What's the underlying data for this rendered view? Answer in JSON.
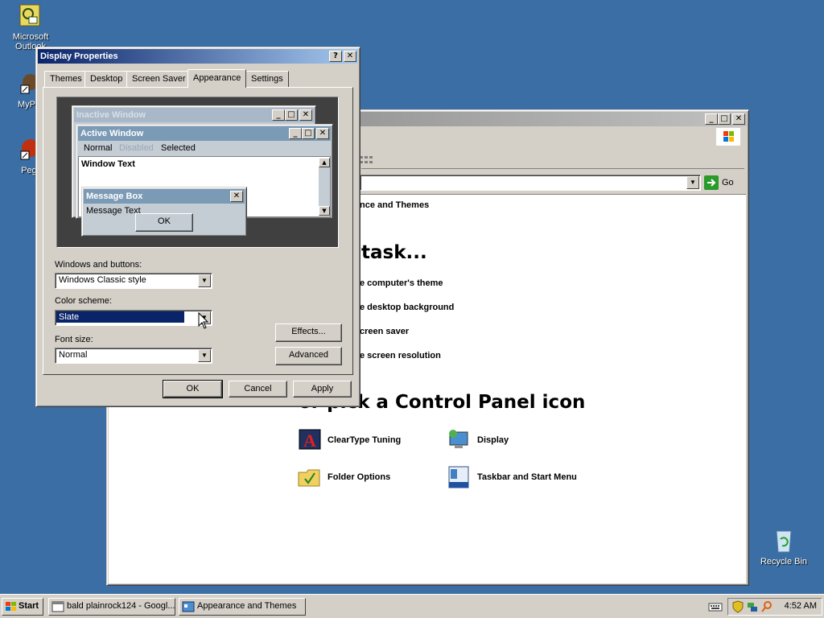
{
  "desktop": {
    "icons": [
      {
        "label": "Microsoft Outlook"
      },
      {
        "label": "MyPa"
      },
      {
        "label": "Peg"
      },
      {
        "label": "Recycle Bin"
      }
    ]
  },
  "control_panel": {
    "breadcrumb_fragment": "nce and Themes",
    "go_label": "Go",
    "task_heading": "task...",
    "tasks": [
      "e computer's theme",
      "e desktop background",
      "creen saver",
      "e screen resolution"
    ],
    "icon_heading": "or pick a Control Panel icon",
    "icons": [
      "ClearType Tuning",
      "Display",
      "Folder Options",
      "Taskbar and Start Menu"
    ]
  },
  "dialog": {
    "title": "Display Properties",
    "help_btn": "?",
    "close_btn": "✕",
    "tabs": [
      "Themes",
      "Desktop",
      "Screen Saver",
      "Appearance",
      "Settings"
    ],
    "active_tab": "Appearance",
    "preview": {
      "inactive_title": "Inactive Window",
      "active_title": "Active Window",
      "menu": [
        "Normal",
        "Disabled",
        "Selected"
      ],
      "window_text": "Window Text",
      "msgbox_title": "Message Box",
      "msgbox_text": "Message Text",
      "msgbox_ok": "OK"
    },
    "windows_buttons_label": "Windows and buttons:",
    "windows_buttons_value": "Windows Classic style",
    "color_scheme_label": "Color scheme:",
    "color_scheme_value": "Slate",
    "font_size_label": "Font size:",
    "font_size_value": "Normal",
    "effects_btn": "Effects...",
    "advanced_btn": "Advanced",
    "ok_btn": "OK",
    "cancel_btn": "Cancel",
    "apply_btn": "Apply"
  },
  "taskbar": {
    "start": "Start",
    "tasks": [
      "bald plainrock124 - Googl...",
      "Appearance and Themes"
    ],
    "clock": "4:52 AM"
  },
  "colors": {
    "desktop": "#3a6ea5",
    "face": "#d4d0c8",
    "active_title": "#0a246a",
    "slate_title": "#7b9ab5"
  }
}
